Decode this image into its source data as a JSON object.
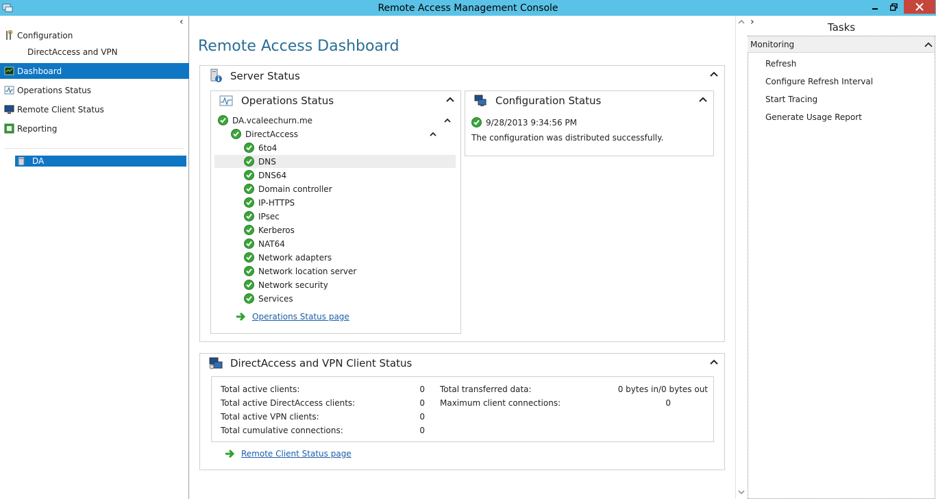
{
  "window": {
    "title": "Remote Access Management Console"
  },
  "left_nav": {
    "items": [
      {
        "label": "Configuration",
        "icon": "tools-icon"
      },
      {
        "label": "DirectAccess and VPN",
        "icon": ""
      },
      {
        "label": "Dashboard",
        "icon": "dashboard-icon",
        "selected": true
      },
      {
        "label": "Operations Status",
        "icon": "pulse-icon"
      },
      {
        "label": "Remote Client Status",
        "icon": "monitor-icon"
      },
      {
        "label": "Reporting",
        "icon": "report-icon"
      }
    ],
    "server": "DA"
  },
  "main": {
    "title": "Remote Access Dashboard",
    "server_status": {
      "title": "Server Status",
      "operations": {
        "title": "Operations Status",
        "server": "DA.vcaleechurn.me",
        "group": "DirectAccess",
        "components": [
          "6to4",
          "DNS",
          "DNS64",
          "Domain controller",
          "IP-HTTPS",
          "IPsec",
          "Kerberos",
          "NAT64",
          "Network adapters",
          "Network location server",
          "Network security",
          "Services"
        ],
        "link": "Operations Status page"
      },
      "configuration": {
        "title": "Configuration Status",
        "timestamp": "9/28/2013 9:34:56 PM",
        "message": "The configuration was distributed successfully."
      }
    },
    "client_status": {
      "title": "DirectAccess and VPN Client Status",
      "left_stats": [
        {
          "label": "Total active clients:",
          "value": "0"
        },
        {
          "label": "Total active DirectAccess clients:",
          "value": "0"
        },
        {
          "label": "Total active VPN clients:",
          "value": "0"
        },
        {
          "label": "Total cumulative connections:",
          "value": "0"
        }
      ],
      "right_stats": [
        {
          "label": "Total transferred data:",
          "value": "0 bytes in/0 bytes out"
        },
        {
          "label": "Maximum client connections:",
          "value": "0"
        }
      ],
      "link": "Remote Client Status page"
    }
  },
  "tasks": {
    "title": "Tasks",
    "section": "Monitoring",
    "items": [
      "Refresh",
      "Configure Refresh Interval",
      "Start Tracing",
      "Generate Usage Report"
    ]
  },
  "colors": {
    "titlebar": "#5bc2e7",
    "selected": "#0f76c4",
    "heading": "#2a6e95",
    "ok_green": "#3aa53a"
  }
}
